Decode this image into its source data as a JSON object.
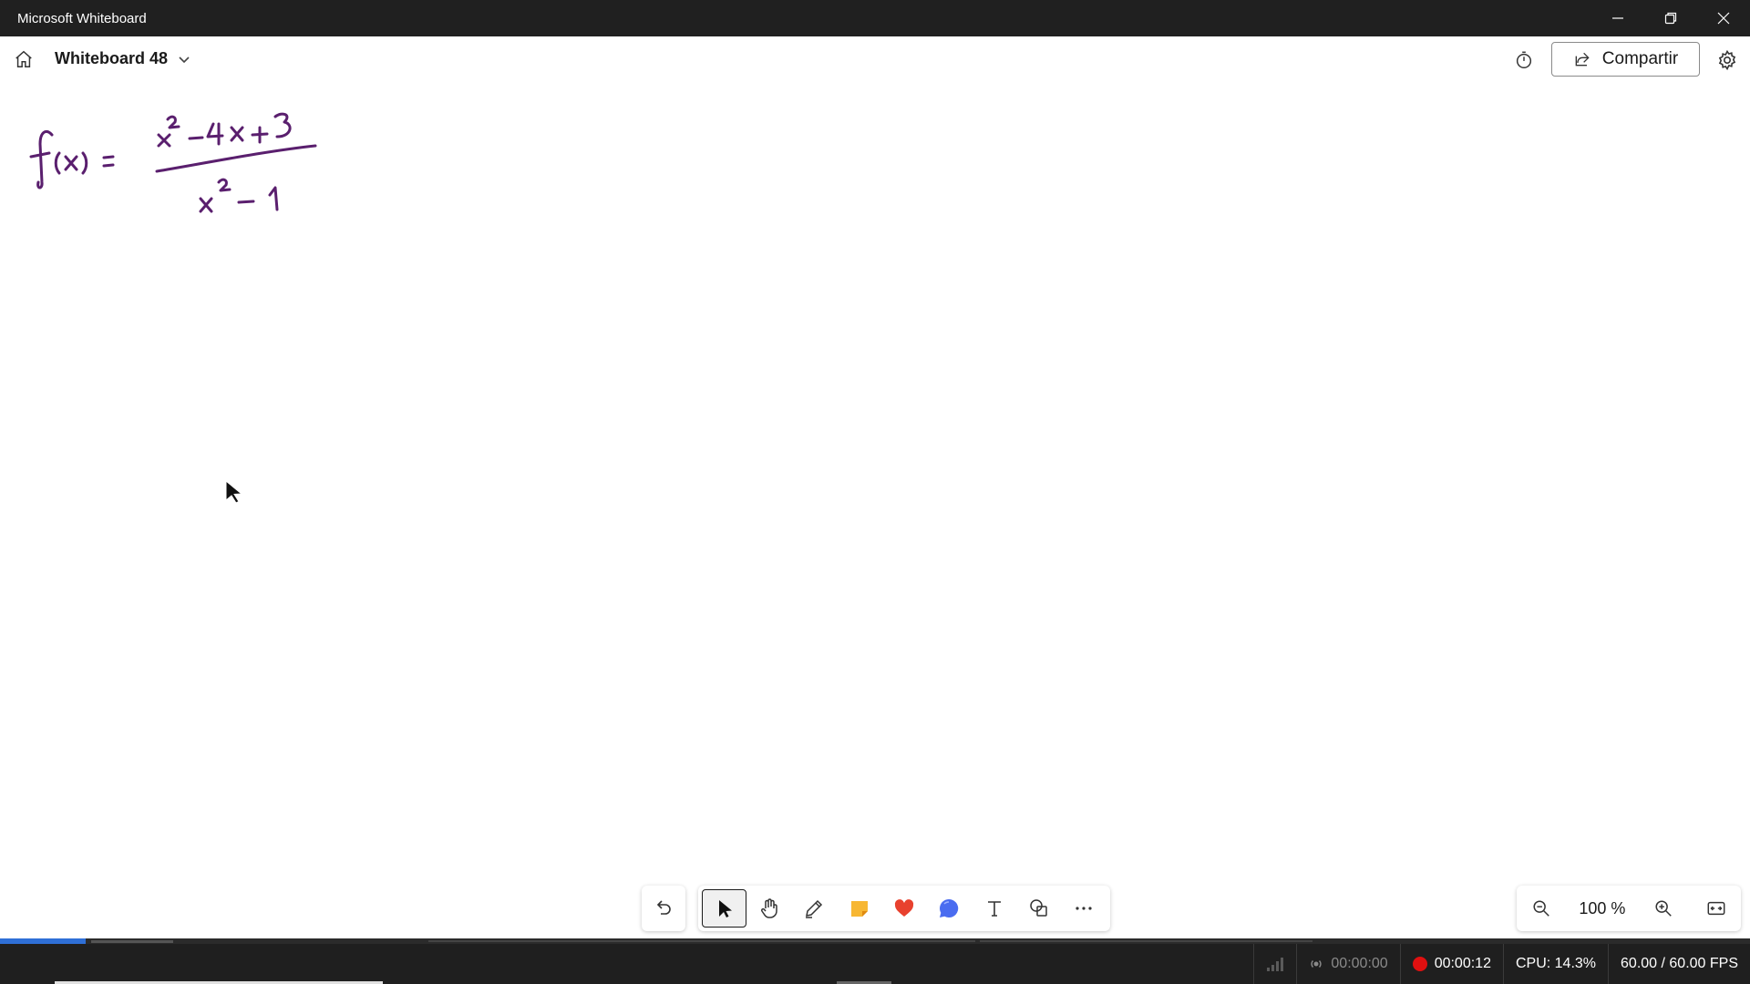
{
  "window": {
    "title": "Microsoft Whiteboard"
  },
  "header": {
    "board_name": "Whiteboard 48",
    "share_label": "Compartir"
  },
  "zoom": {
    "level": "100 %"
  },
  "ink_color": "#5a1f6e",
  "status": {
    "stream_time": "00:00:00",
    "record_time": "00:00:12",
    "cpu": "CPU: 14.3%",
    "fps": "60.00 / 60.00 FPS"
  }
}
